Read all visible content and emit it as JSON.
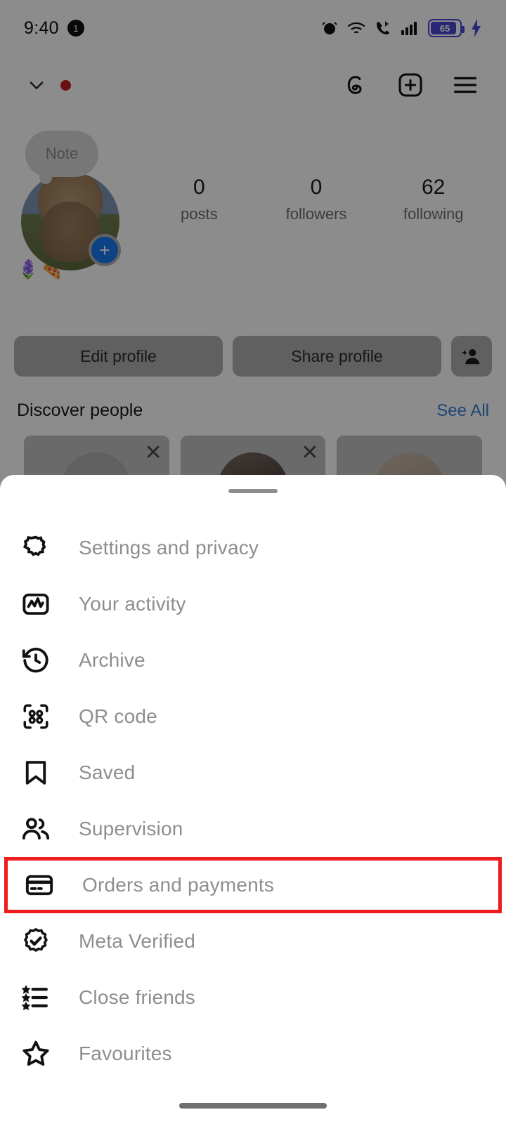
{
  "status_bar": {
    "time": "9:40",
    "notification_count": "1",
    "icons": [
      "alarm-icon",
      "wifi-icon",
      "call-icon",
      "signal-icon",
      "battery-icon",
      "charging-icon"
    ],
    "battery_percent": "65"
  },
  "header": {
    "username": "",
    "chevron_icon": "chevron-down-icon",
    "notification_dot": "",
    "threads_icon": "threads-icon",
    "new_post_icon": "plus-square-icon",
    "menu_icon": "hamburger-menu-icon"
  },
  "profile": {
    "note_label": "Note",
    "avatar_add_icon": "plus-icon",
    "bio": "🪻🍕",
    "stats": [
      {
        "value": "0",
        "label": "posts"
      },
      {
        "value": "0",
        "label": "followers"
      },
      {
        "value": "62",
        "label": "following"
      }
    ],
    "actions": {
      "edit_profile": "Edit profile",
      "share_profile": "Share profile",
      "add_person_icon": "add-person-icon"
    }
  },
  "discover": {
    "title": "Discover people",
    "see_all": "See All",
    "dismiss_icon": "close-icon",
    "cards": [
      "",
      "",
      ""
    ]
  },
  "sheet": {
    "handle": "drag-handle",
    "highlight_color": "#ee1c1c",
    "items": [
      {
        "icon": "gear-icon",
        "label": "Settings and privacy",
        "highlighted": false
      },
      {
        "icon": "activity-icon",
        "label": "Your activity",
        "highlighted": false
      },
      {
        "icon": "archive-icon",
        "label": "Archive",
        "highlighted": false
      },
      {
        "icon": "qr-code-icon",
        "label": "QR code",
        "highlighted": false
      },
      {
        "icon": "bookmark-icon",
        "label": "Saved",
        "highlighted": false
      },
      {
        "icon": "supervision-icon",
        "label": "Supervision",
        "highlighted": false
      },
      {
        "icon": "credit-card-icon",
        "label": "Orders and payments",
        "highlighted": true
      },
      {
        "icon": "verified-badge-icon",
        "label": "Meta Verified",
        "highlighted": false
      },
      {
        "icon": "star-list-icon",
        "label": "Close friends",
        "highlighted": false
      },
      {
        "icon": "star-icon",
        "label": "Favourites",
        "highlighted": false
      }
    ]
  },
  "nav": {
    "home_indicator": "home-indicator"
  }
}
